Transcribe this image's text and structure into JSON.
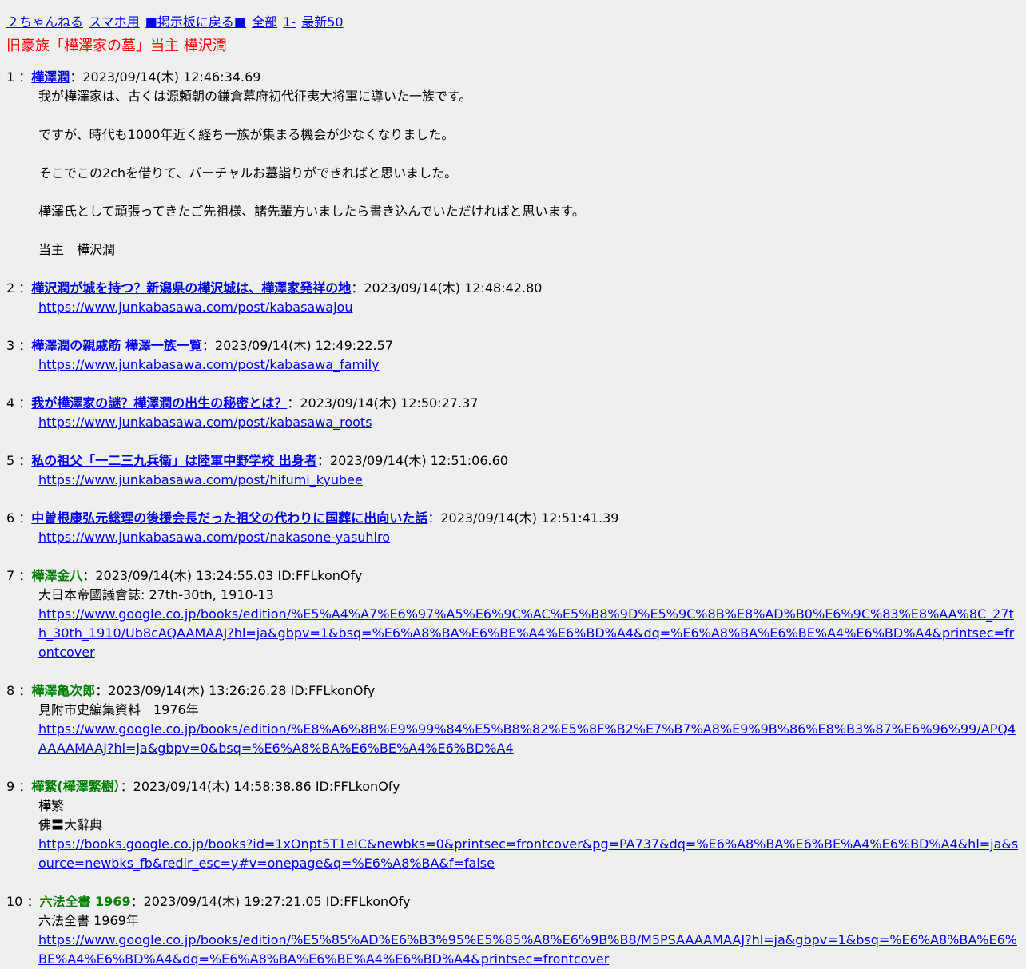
{
  "nav": {
    "site": "２ちゃんねる",
    "mobile": "スマホ用",
    "back": "■掲示板に戻る■",
    "all": "全部",
    "first": "1-",
    "latest": "最新50"
  },
  "thread": {
    "title": "旧豪族「樺澤家の墓」当主 樺沢潤"
  },
  "posts": [
    {
      "num": "1",
      "name": "樺澤潤",
      "meta": "2023/09/14(木) 12:46:34.69",
      "lines": [
        "我が樺澤家は、古くは源頼朝の鎌倉幕府初代征夷大将軍に導いた一族です。",
        "",
        "ですが、時代も1000年近く経ち一族が集まる機会が少なくなりました。",
        "",
        "そこでこの2chを借りて、バーチャルお墓詣りができればと思いました。",
        "",
        "樺澤氏として頑張ってきたご先祖様、諸先輩方いましたら書き込んでいただければと思います。",
        "",
        "当主　樺沢潤"
      ]
    },
    {
      "num": "2",
      "name": "樺沢潤が城を持つ？新潟県の樺沢城は、樺澤家発祥の地",
      "meta": "2023/09/14(木) 12:48:42.80",
      "url": "https://www.junkabasawa.com/post/kabasawajou"
    },
    {
      "num": "3",
      "name": "樺澤潤の親戚筋 樺澤一族一覧",
      "meta": "2023/09/14(木) 12:49:22.57",
      "url": "https://www.junkabasawa.com/post/kabasawa_family"
    },
    {
      "num": "4",
      "name": "我が樺澤家の謎？樺澤潤の出生の秘密とは？",
      "meta": "2023/09/14(木) 12:50:27.37",
      "url": "https://www.junkabasawa.com/post/kabasawa_roots"
    },
    {
      "num": "5",
      "name": "私の祖父「一二三九兵衛」は陸軍中野学校 出身者",
      "meta": "2023/09/14(木) 12:51:06.60",
      "url": "https://www.junkabasawa.com/post/hifumi_kyubee"
    },
    {
      "num": "6",
      "name": "中曽根康弘元総理の後援会長だった祖父の代わりに国葬に出向いた話",
      "meta": "2023/09/14(木) 12:51:41.39",
      "url": "https://www.junkabasawa.com/post/nakasone-yasuhiro"
    },
    {
      "num": "7",
      "name": "樺澤金八",
      "meta": "2023/09/14(木) 13:24:55.03 ID:FFLkonOfy",
      "text": "大日本帝國議會誌: 27th-30th, 1910-13",
      "url": "https://www.google.co.jp/books/edition/%E5%A4%A7%E6%97%A5%E6%9C%AC%E5%B8%9D%E5%9C%8B%E8%AD%B0%E6%9C%83%E8%AA%8C_27th_30th_1910/Ub8cAQAAMAAJ?hl=ja&gbpv=1&bsq=%E6%A8%BA%E6%BE%A4%E6%BD%A4&dq=%E6%A8%BA%E6%BE%A4%E6%BD%A4&printsec=frontcover"
    },
    {
      "num": "8",
      "name": "樺澤亀次郎",
      "meta": "2023/09/14(木) 13:26:26.28 ID:FFLkonOfy",
      "text": "見附市史編集資料　1976年",
      "url": "https://www.google.co.jp/books/edition/%E8%A6%8B%E9%99%84%E5%B8%82%E5%8F%B2%E7%B7%A8%E9%9B%86%E8%B3%87%E6%96%99/APQ4AAAAMAAJ?hl=ja&gbpv=0&bsq=%E6%A8%BA%E6%BE%A4%E6%BD%A4"
    },
    {
      "num": "9",
      "name": "樺繁(樺澤繁樹）",
      "meta": "2023/09/14(木) 14:58:38.86 ID:FFLkonOfy",
      "text": "樺繁",
      "text2": "佛〓大辭典",
      "url": "https://books.google.co.jp/books?id=1xOnpt5T1eIC&newbks=0&printsec=frontcover&pg=PA737&dq=%E6%A8%BA%E6%BE%A4%E6%BD%A4&hl=ja&source=newbks_fb&redir_esc=y#v=onepage&q=%E6%A8%BA&f=false"
    },
    {
      "num": "10",
      "name": "六法全書 1969",
      "meta": "2023/09/14(木) 19:27:21.05 ID:FFLkonOfy",
      "text": "六法全書 1969年",
      "url": "https://www.google.co.jp/books/edition/%E5%85%AD%E6%B3%95%E5%85%A8%E6%9B%B8/M5PSAAAAMAAJ?hl=ja&gbpv=1&bsq=%E6%A8%BA%E6%BE%A4%E6%BD%A4&dq=%E6%A8%BA%E6%BE%A4%E6%BD%A4&printsec=frontcover"
    }
  ],
  "separators": {
    "colon": "："
  }
}
